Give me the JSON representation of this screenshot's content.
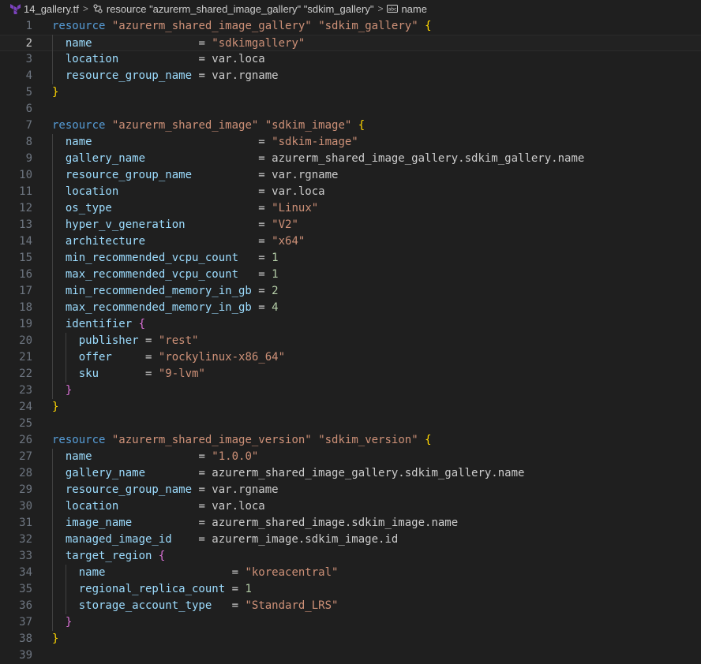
{
  "breadcrumb": {
    "file": "14_gallery.tf",
    "resource": "resource \"azurerm_shared_image_gallery\" \"sdkim_gallery\"",
    "field": "name"
  },
  "colors": {
    "keyword": "#569cd6",
    "string": "#ce9178",
    "attribute": "#9cdcfe",
    "number": "#b5cea8",
    "brace_level1": "#ffd700",
    "brace_level2": "#da70d6",
    "terraform_icon": "#7b42bc"
  },
  "editor": {
    "active_line": 2,
    "lines": [
      {
        "n": "1",
        "tokens": [
          [
            "kw",
            "resource"
          ],
          [
            "plain",
            " "
          ],
          [
            "str",
            "\"azurerm_shared_image_gallery\""
          ],
          [
            "plain",
            " "
          ],
          [
            "str",
            "\"sdkim_gallery\""
          ],
          [
            "plain",
            " "
          ],
          [
            "brace",
            "{"
          ]
        ]
      },
      {
        "n": "2",
        "tokens": [
          [
            "plain",
            "  "
          ],
          [
            "attr",
            "name"
          ],
          [
            "plain",
            "                = "
          ],
          [
            "str",
            "\"sdkimgallery\""
          ]
        ]
      },
      {
        "n": "3",
        "tokens": [
          [
            "plain",
            "  "
          ],
          [
            "attr",
            "location"
          ],
          [
            "plain",
            "            = var.loca"
          ]
        ]
      },
      {
        "n": "4",
        "tokens": [
          [
            "plain",
            "  "
          ],
          [
            "attr",
            "resource_group_name"
          ],
          [
            "plain",
            " = var.rgname"
          ]
        ]
      },
      {
        "n": "5",
        "tokens": [
          [
            "brace",
            "}"
          ]
        ]
      },
      {
        "n": "6",
        "tokens": []
      },
      {
        "n": "7",
        "tokens": [
          [
            "kw",
            "resource"
          ],
          [
            "plain",
            " "
          ],
          [
            "str",
            "\"azurerm_shared_image\""
          ],
          [
            "plain",
            " "
          ],
          [
            "str",
            "\"sdkim_image\""
          ],
          [
            "plain",
            " "
          ],
          [
            "brace",
            "{"
          ]
        ]
      },
      {
        "n": "8",
        "tokens": [
          [
            "plain",
            "  "
          ],
          [
            "attr",
            "name"
          ],
          [
            "plain",
            "                         = "
          ],
          [
            "str",
            "\"sdkim-image\""
          ]
        ]
      },
      {
        "n": "9",
        "tokens": [
          [
            "plain",
            "  "
          ],
          [
            "attr",
            "gallery_name"
          ],
          [
            "plain",
            "                 = azurerm_shared_image_gallery.sdkim_gallery.name"
          ]
        ]
      },
      {
        "n": "10",
        "tokens": [
          [
            "plain",
            "  "
          ],
          [
            "attr",
            "resource_group_name"
          ],
          [
            "plain",
            "          = var.rgname"
          ]
        ]
      },
      {
        "n": "11",
        "tokens": [
          [
            "plain",
            "  "
          ],
          [
            "attr",
            "location"
          ],
          [
            "plain",
            "                     = var.loca"
          ]
        ]
      },
      {
        "n": "12",
        "tokens": [
          [
            "plain",
            "  "
          ],
          [
            "attr",
            "os_type"
          ],
          [
            "plain",
            "                      = "
          ],
          [
            "str",
            "\"Linux\""
          ]
        ]
      },
      {
        "n": "13",
        "tokens": [
          [
            "plain",
            "  "
          ],
          [
            "attr",
            "hyper_v_generation"
          ],
          [
            "plain",
            "           = "
          ],
          [
            "str",
            "\"V2\""
          ]
        ]
      },
      {
        "n": "14",
        "tokens": [
          [
            "plain",
            "  "
          ],
          [
            "attr",
            "architecture"
          ],
          [
            "plain",
            "                 = "
          ],
          [
            "str",
            "\"x64\""
          ]
        ]
      },
      {
        "n": "15",
        "tokens": [
          [
            "plain",
            "  "
          ],
          [
            "attr",
            "min_recommended_vcpu_count"
          ],
          [
            "plain",
            "   = "
          ],
          [
            "num",
            "1"
          ]
        ]
      },
      {
        "n": "16",
        "tokens": [
          [
            "plain",
            "  "
          ],
          [
            "attr",
            "max_recommended_vcpu_count"
          ],
          [
            "plain",
            "   = "
          ],
          [
            "num",
            "1"
          ]
        ]
      },
      {
        "n": "17",
        "tokens": [
          [
            "plain",
            "  "
          ],
          [
            "attr",
            "min_recommended_memory_in_gb"
          ],
          [
            "plain",
            " = "
          ],
          [
            "num",
            "2"
          ]
        ]
      },
      {
        "n": "18",
        "tokens": [
          [
            "plain",
            "  "
          ],
          [
            "attr",
            "max_recommended_memory_in_gb"
          ],
          [
            "plain",
            " = "
          ],
          [
            "num",
            "4"
          ]
        ]
      },
      {
        "n": "19",
        "tokens": [
          [
            "plain",
            "  "
          ],
          [
            "attr",
            "identifier"
          ],
          [
            "plain",
            " "
          ],
          [
            "brace2",
            "{"
          ]
        ]
      },
      {
        "n": "20",
        "tokens": [
          [
            "plain",
            "    "
          ],
          [
            "attr",
            "publisher"
          ],
          [
            "plain",
            " = "
          ],
          [
            "str",
            "\"rest\""
          ]
        ]
      },
      {
        "n": "21",
        "tokens": [
          [
            "plain",
            "    "
          ],
          [
            "attr",
            "offer"
          ],
          [
            "plain",
            "     = "
          ],
          [
            "str",
            "\"rockylinux-x86_64\""
          ]
        ]
      },
      {
        "n": "22",
        "tokens": [
          [
            "plain",
            "    "
          ],
          [
            "attr",
            "sku"
          ],
          [
            "plain",
            "       = "
          ],
          [
            "str",
            "\"9-lvm\""
          ]
        ]
      },
      {
        "n": "23",
        "tokens": [
          [
            "plain",
            "  "
          ],
          [
            "brace2",
            "}"
          ]
        ]
      },
      {
        "n": "24",
        "tokens": [
          [
            "brace",
            "}"
          ]
        ]
      },
      {
        "n": "25",
        "tokens": []
      },
      {
        "n": "26",
        "tokens": [
          [
            "kw",
            "resource"
          ],
          [
            "plain",
            " "
          ],
          [
            "str",
            "\"azurerm_shared_image_version\""
          ],
          [
            "plain",
            " "
          ],
          [
            "str",
            "\"sdkim_version\""
          ],
          [
            "plain",
            " "
          ],
          [
            "brace",
            "{"
          ]
        ]
      },
      {
        "n": "27",
        "tokens": [
          [
            "plain",
            "  "
          ],
          [
            "attr",
            "name"
          ],
          [
            "plain",
            "                = "
          ],
          [
            "str",
            "\"1.0.0\""
          ]
        ]
      },
      {
        "n": "28",
        "tokens": [
          [
            "plain",
            "  "
          ],
          [
            "attr",
            "gallery_name"
          ],
          [
            "plain",
            "        = azurerm_shared_image_gallery.sdkim_gallery.name"
          ]
        ]
      },
      {
        "n": "29",
        "tokens": [
          [
            "plain",
            "  "
          ],
          [
            "attr",
            "resource_group_name"
          ],
          [
            "plain",
            " = var.rgname"
          ]
        ]
      },
      {
        "n": "30",
        "tokens": [
          [
            "plain",
            "  "
          ],
          [
            "attr",
            "location"
          ],
          [
            "plain",
            "            = var.loca"
          ]
        ]
      },
      {
        "n": "31",
        "tokens": [
          [
            "plain",
            "  "
          ],
          [
            "attr",
            "image_name"
          ],
          [
            "plain",
            "          = azurerm_shared_image.sdkim_image.name"
          ]
        ]
      },
      {
        "n": "32",
        "tokens": [
          [
            "plain",
            "  "
          ],
          [
            "attr",
            "managed_image_id"
          ],
          [
            "plain",
            "    = azurerm_image.sdkim_image.id"
          ]
        ]
      },
      {
        "n": "33",
        "tokens": [
          [
            "plain",
            "  "
          ],
          [
            "attr",
            "target_region"
          ],
          [
            "plain",
            " "
          ],
          [
            "brace2",
            "{"
          ]
        ]
      },
      {
        "n": "34",
        "tokens": [
          [
            "plain",
            "    "
          ],
          [
            "attr",
            "name"
          ],
          [
            "plain",
            "                   = "
          ],
          [
            "str",
            "\"koreacentral\""
          ]
        ]
      },
      {
        "n": "35",
        "tokens": [
          [
            "plain",
            "    "
          ],
          [
            "attr",
            "regional_replica_count"
          ],
          [
            "plain",
            " = "
          ],
          [
            "num",
            "1"
          ]
        ]
      },
      {
        "n": "36",
        "tokens": [
          [
            "plain",
            "    "
          ],
          [
            "attr",
            "storage_account_type"
          ],
          [
            "plain",
            "   = "
          ],
          [
            "str",
            "\"Standard_LRS\""
          ]
        ]
      },
      {
        "n": "37",
        "tokens": [
          [
            "plain",
            "  "
          ],
          [
            "brace2",
            "}"
          ]
        ]
      },
      {
        "n": "38",
        "tokens": [
          [
            "brace",
            "}"
          ]
        ]
      },
      {
        "n": "39",
        "tokens": []
      }
    ]
  }
}
